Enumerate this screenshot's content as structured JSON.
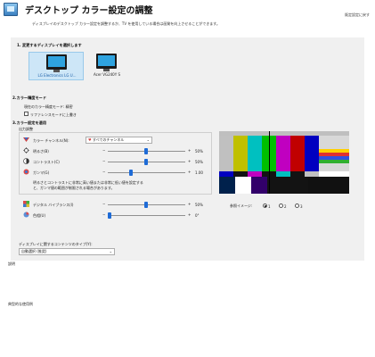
{
  "header": {
    "title": "デスクトップ カラー設定の調整",
    "description": "ディスプレイのデスクトップ カラー設定を調整するか、TV を使用している場合は画質を向上させることができます。",
    "restore_link": "既定設定に戻す"
  },
  "section1": {
    "heading": "1. 変更するディスプレイを選択します",
    "displays": [
      {
        "label": "LG Electronics LG U...",
        "selected": true
      },
      {
        "label": "Acer VG240Y S",
        "selected": false
      }
    ]
  },
  "section2": {
    "heading": "2.カラー精度モード",
    "current_mode": "現在のカラー精度モード: 精密",
    "override_label": "リファレンスモードに上書き"
  },
  "section3": {
    "heading": "3.カラー設定を適用",
    "output_group": "出力調整",
    "color_channel_label": "カラー チャンネル(N):",
    "color_channel_value": "すべてのチャンネル",
    "rows": [
      {
        "label": "明るさ(B)",
        "value": "50%",
        "level": 0.5
      },
      {
        "label": "コントラスト(C)",
        "value": "50%",
        "level": 0.5
      },
      {
        "label": "ガンマ(G)",
        "value": "1.00",
        "level": 0.4
      }
    ],
    "gamma_warning": "明るさとコントラストに非常に高い値または非常に低い値を設定すると、ガンマ値の範囲が制限される場合があります。",
    "digital_vibrance_label": "デジタル バイブランス(I)",
    "digital_vibrance_value": "50%",
    "digital_vibrance_level": 0.5,
    "hue_label": "色相(U)",
    "hue_value": "0°",
    "hue_level": 0.0
  },
  "reference": {
    "label": "参照イメージ:",
    "options": [
      "1",
      "2",
      "3"
    ],
    "selected_index": 0
  },
  "content_type": {
    "label": "ディスプレイに関するコンテンツのタイプ(Y):",
    "value": "自動選択 (推奨)"
  },
  "footer": {
    "description_heading": "説明",
    "typical_usage_heading": "典型的な使用例"
  },
  "colors": {
    "accent": "#1e6bd6",
    "panel_bg": "#f0f0f0",
    "selection_bg": "#cde6f7"
  }
}
